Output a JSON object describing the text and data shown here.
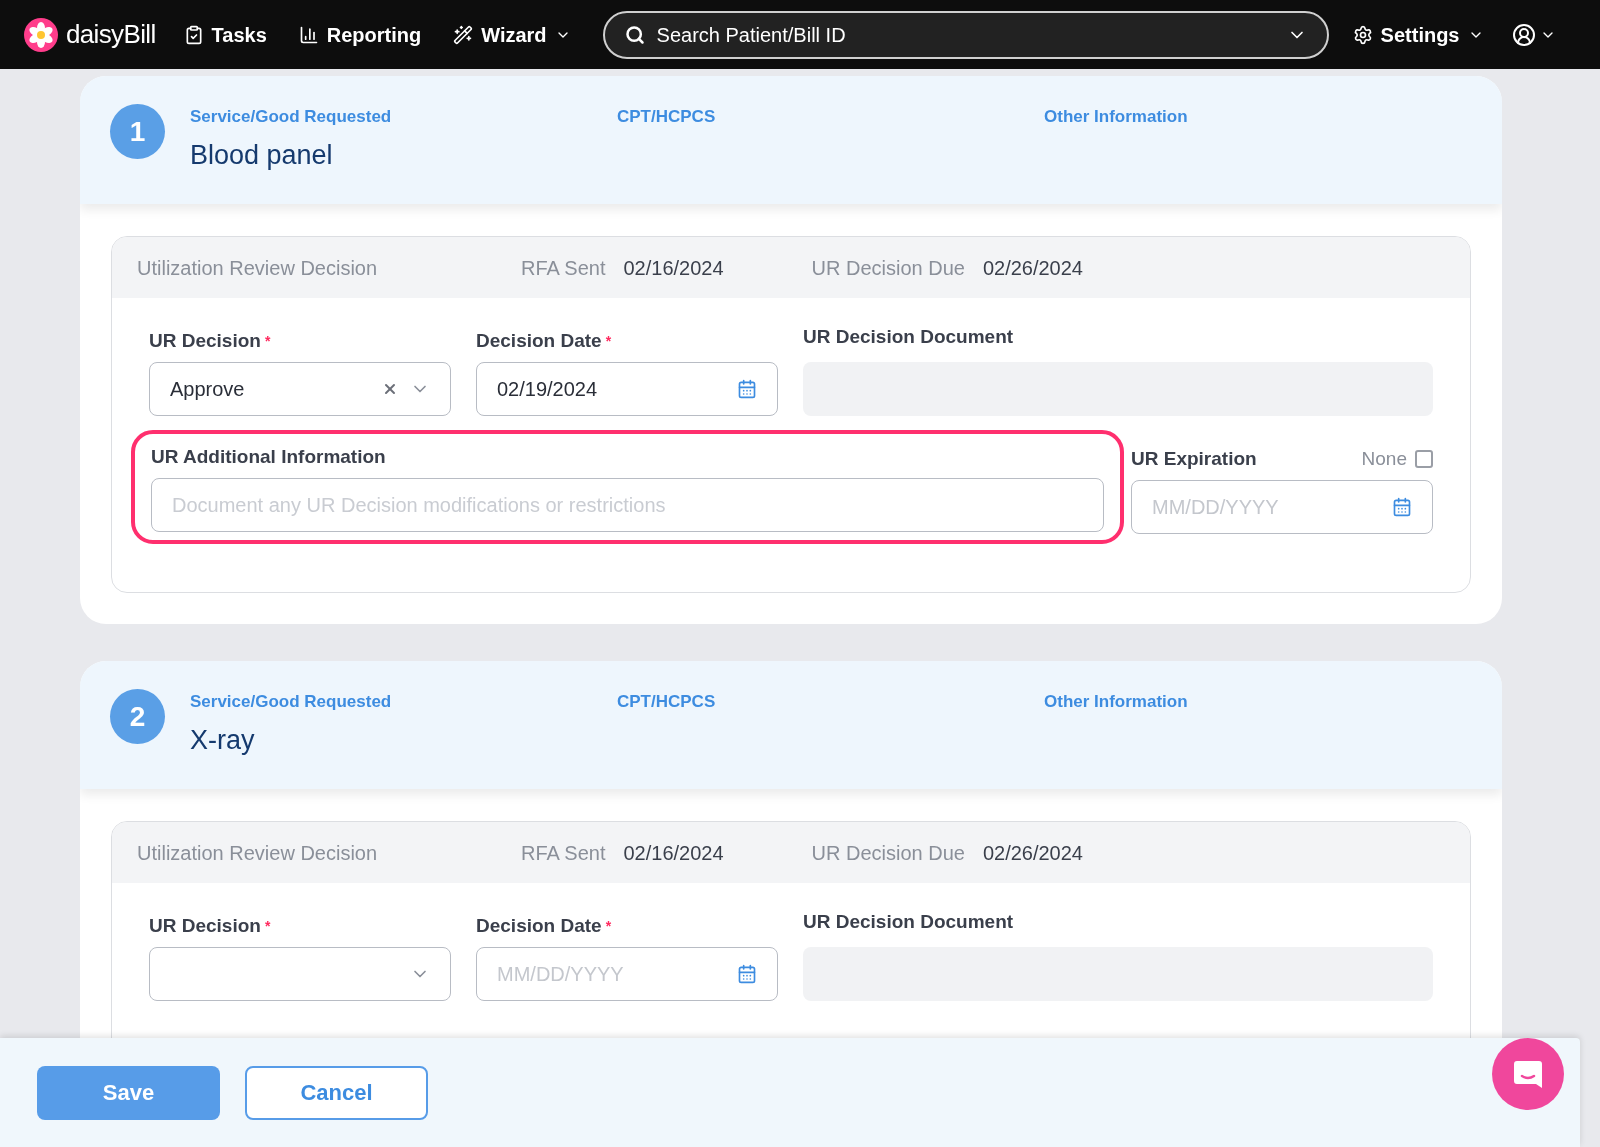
{
  "nav": {
    "brand": "daisyBill",
    "items": [
      {
        "label": "Tasks",
        "kind": "tasks"
      },
      {
        "label": "Reporting",
        "kind": "reporting"
      },
      {
        "label": "Wizard",
        "kind": "wizard"
      }
    ],
    "search": {
      "placeholder": "Search Patient/Bill ID"
    },
    "settings": "Settings"
  },
  "cards": [
    {
      "number": "1",
      "columns": [
        "Service/Good Requested",
        "CPT/HCPCS",
        "Other Information"
      ],
      "title": "Blood panel",
      "review": {
        "heading": "Utilization Review Decision",
        "rfa_label": "RFA Sent",
        "rfa_value": "02/16/2024",
        "due_label": "UR Decision Due",
        "due_value": "02/26/2024"
      },
      "fields": [
        {
          "kind": "select",
          "label": "UR Decision",
          "required_mark": "*",
          "value": "Approve"
        },
        {
          "kind": "date",
          "label": "Decision Date",
          "required_mark": "*",
          "value": "02/19/2024"
        },
        {
          "kind": "document",
          "label": "UR Decision Document"
        },
        {
          "kind": "text",
          "label": "UR Additional Information",
          "placeholder": "Document any UR Decision modifications or restrictions",
          "highlighted": true
        },
        {
          "kind": "expiration",
          "label": "UR Expiration",
          "placeholder": "MM/DD/YYYY",
          "none_label": "None",
          "checked": false
        }
      ]
    },
    {
      "number": "2",
      "columns": [
        "Service/Good Requested",
        "CPT/HCPCS",
        "Other Information"
      ],
      "title": "X-ray",
      "review": {
        "heading": "Utilization Review Decision",
        "rfa_label": "RFA Sent",
        "rfa_value": "02/16/2024",
        "due_label": "UR Decision Due",
        "due_value": "02/26/2024"
      },
      "fields": [
        {
          "kind": "select",
          "label": "UR Decision",
          "required_mark": "*"
        },
        {
          "kind": "date",
          "label": "Decision Date",
          "required_mark": "*",
          "placeholder": "MM/DD/YYYY"
        },
        {
          "kind": "document",
          "label": "UR Decision Document"
        }
      ]
    }
  ],
  "footer": {
    "save": "Save",
    "cancel": "Cancel"
  }
}
